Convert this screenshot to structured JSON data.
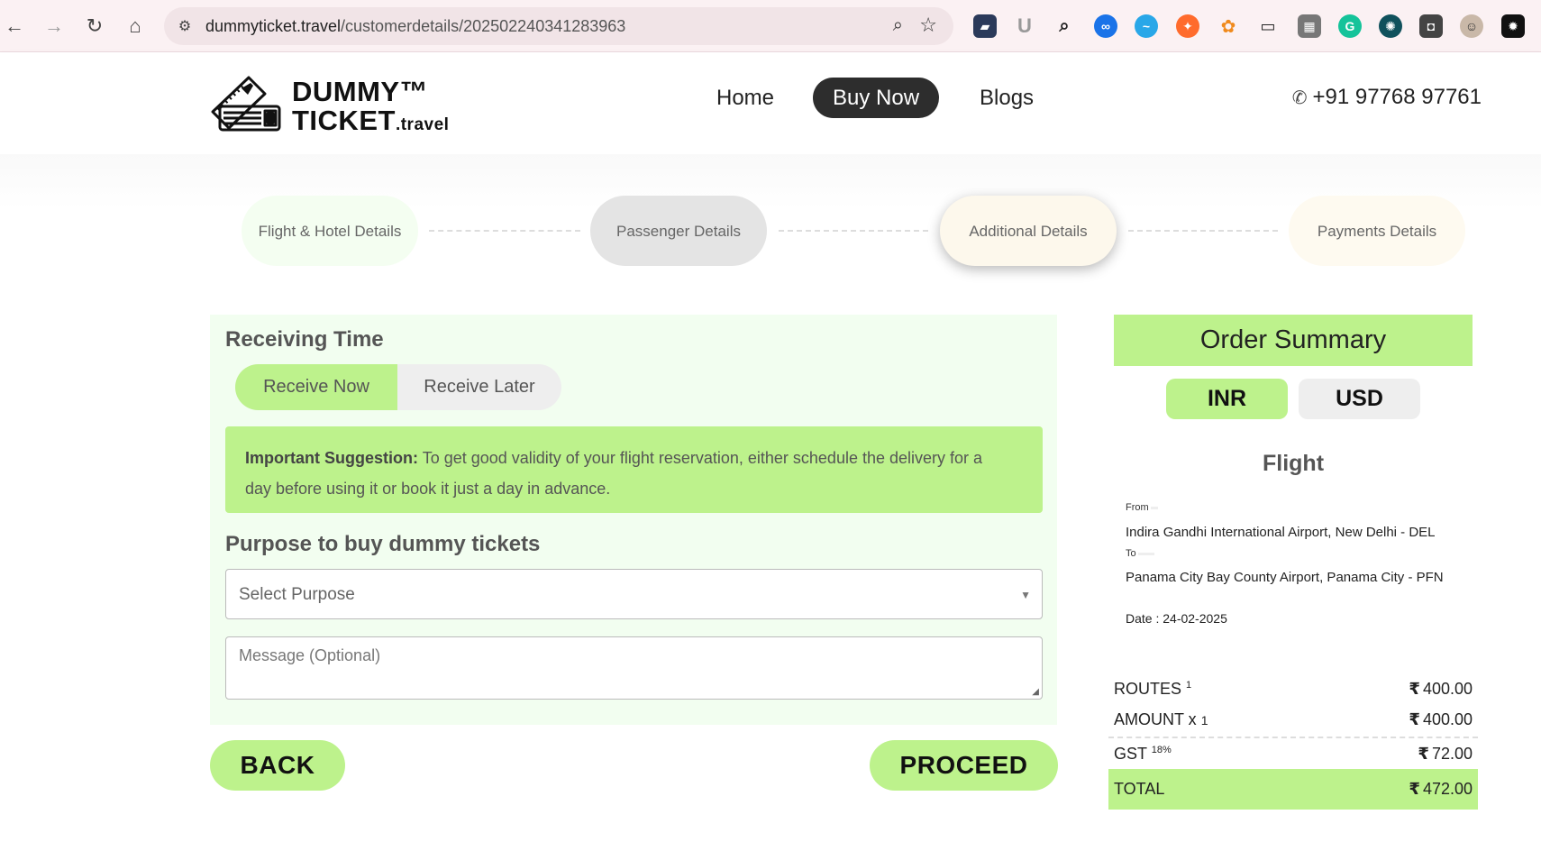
{
  "browser": {
    "url_domain": "dummyticket.travel",
    "url_path": "/customerdetails/202502240341283963",
    "extensions": [
      "folder-icon",
      "u-icon",
      "search-icon",
      "infinity-icon",
      "water-icon",
      "fire-icon",
      "leaf-icon",
      "pip-icon",
      "grid-icon",
      "grammarly-icon",
      "openai-icon",
      "robot-icon",
      "face-icon",
      "chatgpt-icon"
    ]
  },
  "header": {
    "logo_line1": "DUMMY™",
    "logo_line2": "TICKET",
    "logo_suffix": ".travel",
    "nav": {
      "home": "Home",
      "buy_now": "Buy Now",
      "blogs": "Blogs"
    },
    "phone": "+91 97768 97761"
  },
  "steps": [
    {
      "label": "Flight & Hotel Details",
      "bg": "#f4fef1"
    },
    {
      "label": "Passenger Details",
      "bg": "#e4e4e4"
    },
    {
      "label": "Additional Details",
      "bg": "#fdf8ec"
    },
    {
      "label": "Payments Details",
      "bg": "#fefaf0"
    }
  ],
  "receiving": {
    "title": "Receiving Time",
    "receive_now": "Receive Now",
    "receive_later": "Receive Later",
    "suggestion_bold": "Important Suggestion:",
    "suggestion_text": "To get good validity of your flight reservation, either schedule the delivery for a",
    "suggestion_text2": "day before using it or book it just a day in advance."
  },
  "purpose": {
    "title": "Purpose to buy dummy tickets",
    "select_placeholder": "Select Purpose",
    "message_placeholder": "Message (Optional)"
  },
  "actions": {
    "back": "BACK",
    "proceed": "PROCEED"
  },
  "summary": {
    "title": "Order Summary",
    "currency_inr": "INR",
    "currency_usd": "USD",
    "flight_heading": "Flight",
    "from_label": "From",
    "from_airport": "Indira Gandhi International Airport, New Delhi - DEL",
    "to_label": "To",
    "to_airport": "Panama City Bay County Airport, Panama City - PFN",
    "date": "Date : 24-02-2025",
    "rows": {
      "routes_label": "ROUTES",
      "routes_count": "1",
      "routes_value": "400.00",
      "amount_label": "AMOUNT x",
      "amount_count": "1",
      "amount_value": "400.00",
      "gst_label": "GST",
      "gst_rate": "18%",
      "gst_value": "72.00",
      "total_label": "TOTAL",
      "total_value": "472.00",
      "rupee": "₹"
    }
  },
  "colors": {
    "accent_green": "#bdf28c",
    "panel_bg": "#f2fef0",
    "dark_button": "#2d2d2d"
  }
}
